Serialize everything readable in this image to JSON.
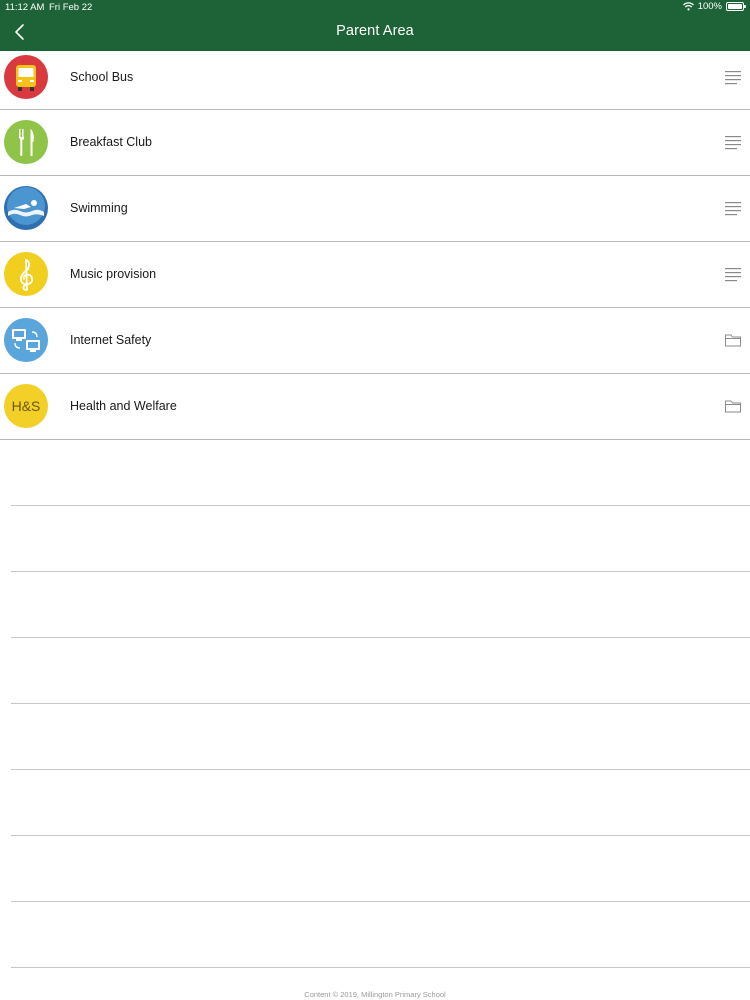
{
  "status_bar": {
    "time": "11:12 AM",
    "date": "Fri Feb 22",
    "battery": "100%"
  },
  "nav": {
    "title": "Parent Area"
  },
  "items": [
    {
      "label": "School Bus",
      "icon": "school-bus-icon",
      "color": "#d83a3f",
      "accessory": "list-lines-icon"
    },
    {
      "label": "Breakfast Club",
      "icon": "cutlery-icon",
      "color": "#8fc449",
      "accessory": "list-lines-icon"
    },
    {
      "label": "Swimming",
      "icon": "swimmer-icon",
      "color": "#3a87c6",
      "accessory": "list-lines-icon"
    },
    {
      "label": "Music provision",
      "icon": "treble-clef-icon",
      "color": "#f0cf1f",
      "accessory": "list-lines-icon"
    },
    {
      "label": "Internet Safety",
      "icon": "computers-icon",
      "color": "#5aa6dc",
      "accessory": "folder-icon"
    },
    {
      "label": "Health and Welfare",
      "icon": "hs-badge-icon",
      "badge_text": "H&S",
      "color": "#f2d028",
      "accessory": "folder-icon"
    }
  ],
  "footer": {
    "text": "Content © 2019, Millington Primary School"
  },
  "colors": {
    "nav_bar": "#1e6338",
    "separator": "#b9b9b9"
  }
}
